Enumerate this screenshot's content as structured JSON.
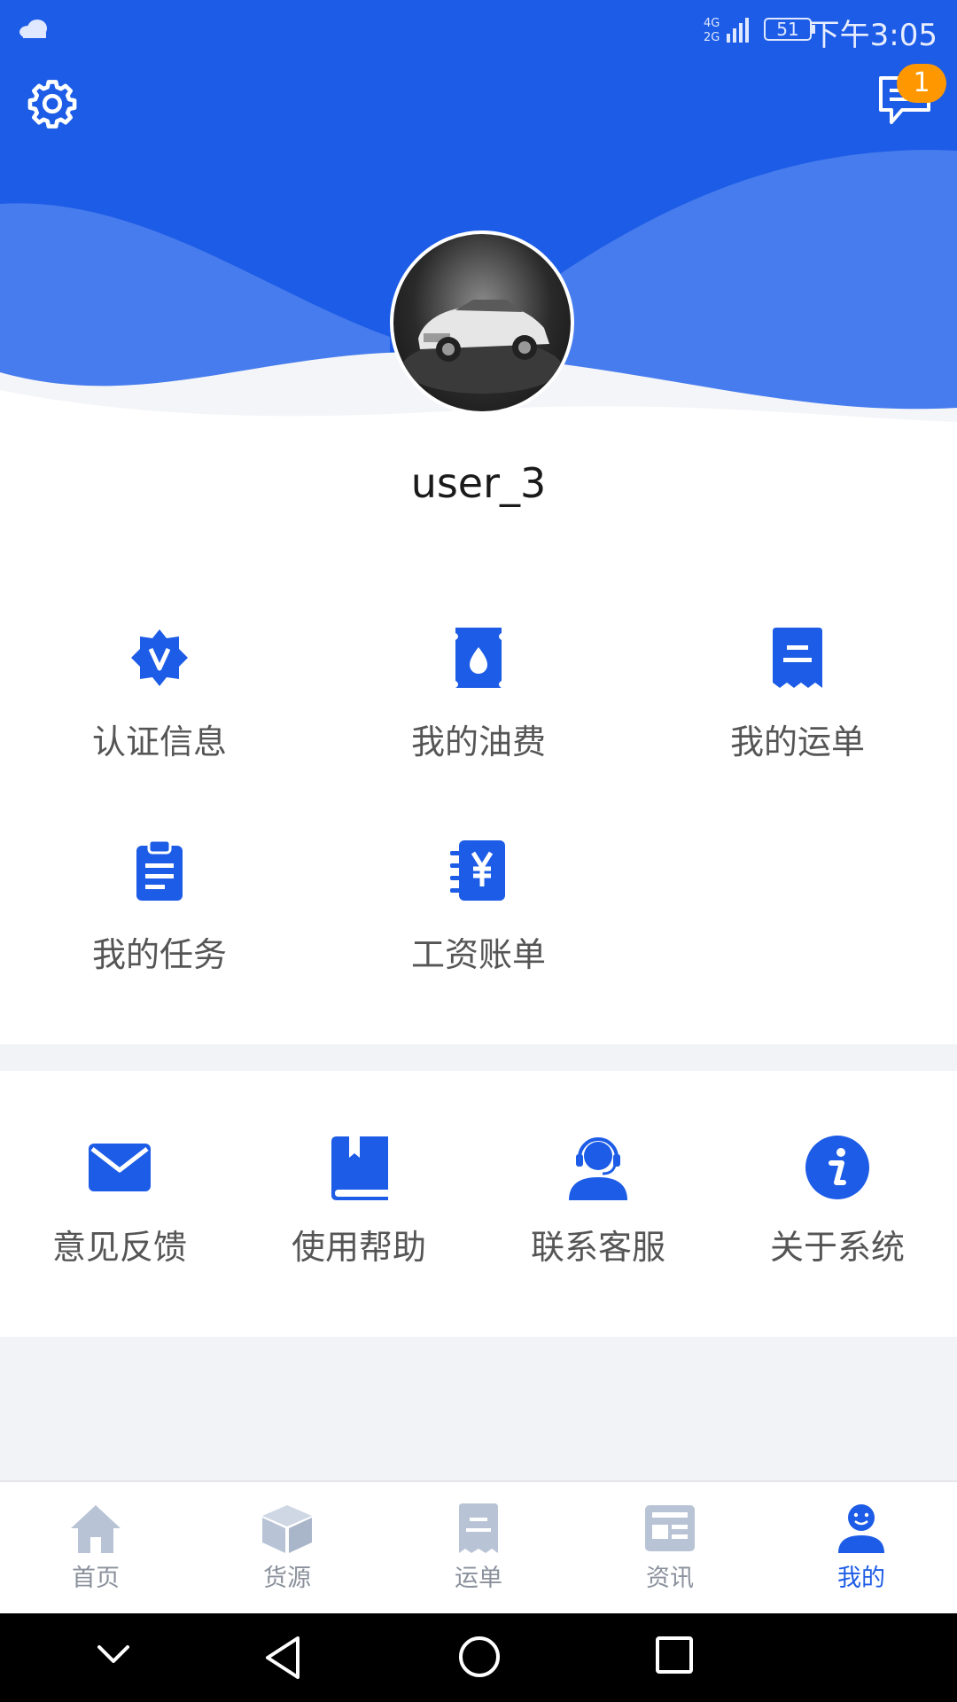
{
  "status_bar": {
    "network": "4G 2G",
    "battery": "51",
    "time": "下午3:05"
  },
  "header": {
    "message_badge": "1",
    "icons": [
      "gear-icon",
      "chat-message-icon"
    ]
  },
  "profile": {
    "username": "user_3"
  },
  "service_grid": [
    {
      "label": "认证信息",
      "icon": "verified-badge-icon"
    },
    {
      "label": "我的油费",
      "icon": "fuel-drop-icon"
    },
    {
      "label": "我的运单",
      "icon": "receipt-icon"
    },
    {
      "label": "我的任务",
      "icon": "clipboard-icon"
    },
    {
      "label": "工资账单",
      "icon": "yuan-notebook-icon"
    }
  ],
  "support_grid": [
    {
      "label": "意见反馈",
      "icon": "envelope-icon"
    },
    {
      "label": "使用帮助",
      "icon": "book-icon"
    },
    {
      "label": "联系客服",
      "icon": "headset-agent-icon"
    },
    {
      "label": "关于系统",
      "icon": "info-icon"
    }
  ],
  "bottom_nav": [
    {
      "label": "首页",
      "icon": "home-icon",
      "active": false
    },
    {
      "label": "货源",
      "icon": "box-icon",
      "active": false
    },
    {
      "label": "运单",
      "icon": "receipt-icon",
      "active": false
    },
    {
      "label": "资讯",
      "icon": "news-icon",
      "active": false
    },
    {
      "label": "我的",
      "icon": "user-icon",
      "active": true
    }
  ],
  "colors": {
    "primary": "#1d5ce6",
    "badge": "#ff9800",
    "nav_inactive": "#b8c4d6",
    "text_gray": "#555555"
  }
}
